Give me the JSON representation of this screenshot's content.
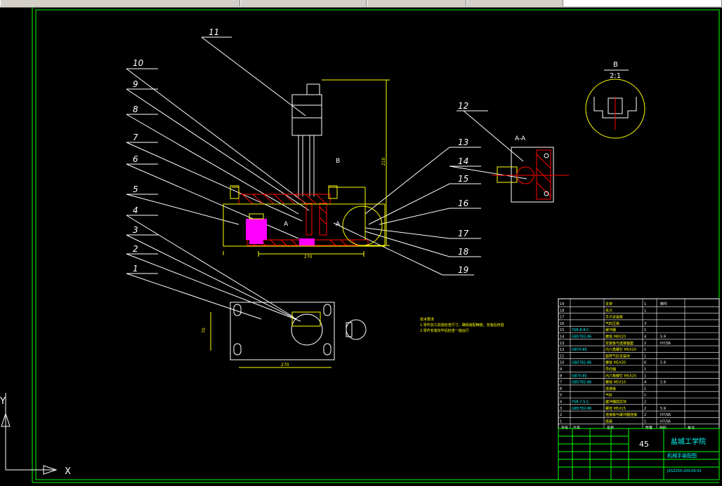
{
  "colors": {
    "frame": "#00ff00",
    "lines": "#ffff00",
    "leaders": "#ffffff",
    "part": "#ff00ff",
    "red": "#ff0000",
    "table": "#00ffff"
  },
  "drawing": {
    "part_numbers": [
      "1",
      "2",
      "3",
      "4",
      "5",
      "6",
      "7",
      "8",
      "9",
      "10",
      "11",
      "12",
      "13",
      "14",
      "15",
      "16",
      "17",
      "18",
      "19"
    ],
    "section_label": "A-A",
    "detail_label": "B",
    "detail_scale": "2:1",
    "view_marker_a": "A",
    "view_marker_b": "B",
    "dims": {
      "base_width": "270",
      "height": "210",
      "plan_width": "270",
      "plan_height": "70"
    },
    "notes_title": "技术要求",
    "notes": [
      "1.零件加工前需检查尺寸，确保装配精度，安装后校验",
      "2.零件安装完毕后检查一遍运行"
    ]
  },
  "title_block": {
    "school": "盐城工学院",
    "drawing_name": "机械手装配图",
    "scale_value": "45",
    "drawing_no": "JXSZ250-20S-09-01",
    "header_cols": [
      "序号",
      "代号",
      "名称",
      "数量",
      "材料",
      "备注"
    ],
    "rows": [
      {
        "no": "19",
        "code": "",
        "name": "支架",
        "qty": "1",
        "note": "铸件"
      },
      {
        "no": "18",
        "code": "",
        "name": "夹爪",
        "qty": "1",
        "note": ""
      },
      {
        "no": "17",
        "code": "",
        "name": "手爪安装板",
        "qty": "",
        "note": ""
      },
      {
        "no": "16",
        "code": "",
        "name": "气缸压板",
        "qty": "3",
        "note": ""
      },
      {
        "no": "15",
        "code": "YSR-8-8-C",
        "name": "缓冲器",
        "qty": "1",
        "note": ""
      },
      {
        "no": "14",
        "code": "GB5782-86",
        "name": "螺栓 M8X20",
        "qty": "4",
        "note": "5.9"
      },
      {
        "no": "13",
        "code": "",
        "name": "安装板与连接轴套",
        "qty": "2",
        "note": "H7/S6"
      },
      {
        "no": "12",
        "code": "GB70-85",
        "name": "内六角螺钉 M5X20",
        "qty": "1",
        "note": ""
      },
      {
        "no": "11",
        "code": "",
        "name": "旋转气缸安装块",
        "qty": "1",
        "note": ""
      },
      {
        "no": "10",
        "code": "GB5782-86",
        "name": "螺栓 M5X30",
        "qty": "6",
        "note": "5.9"
      },
      {
        "no": "9",
        "code": "",
        "name": "导向轴",
        "qty": "1",
        "note": ""
      },
      {
        "no": "8",
        "code": "GB70-85",
        "name": "内六角螺钉 M5X20",
        "qty": "1",
        "note": ""
      },
      {
        "no": "7",
        "code": "GB5782-86",
        "name": "螺栓 M5X10",
        "qty": "4",
        "note": "5.9"
      },
      {
        "no": "6",
        "code": "",
        "name": "连接板",
        "qty": "1",
        "note": ""
      },
      {
        "no": "5",
        "code": "",
        "name": "气缸",
        "qty": "1",
        "note": ""
      },
      {
        "no": "4",
        "code": "YSR-7-5-C",
        "name": "缓冲器固定块",
        "qty": "2",
        "note": ""
      },
      {
        "no": "3",
        "code": "GB5782-86",
        "name": "螺栓 M5X15",
        "qty": "2",
        "note": "5.9"
      },
      {
        "no": "2",
        "code": "",
        "name": "连接板与缓冲器连接",
        "qty": "2",
        "note": "H7/S6"
      },
      {
        "no": "1",
        "code": "",
        "name": "底座",
        "qty": "1",
        "note": "H7/S6"
      }
    ]
  },
  "ucs": {
    "x_label": "X",
    "y_label": "Y"
  }
}
